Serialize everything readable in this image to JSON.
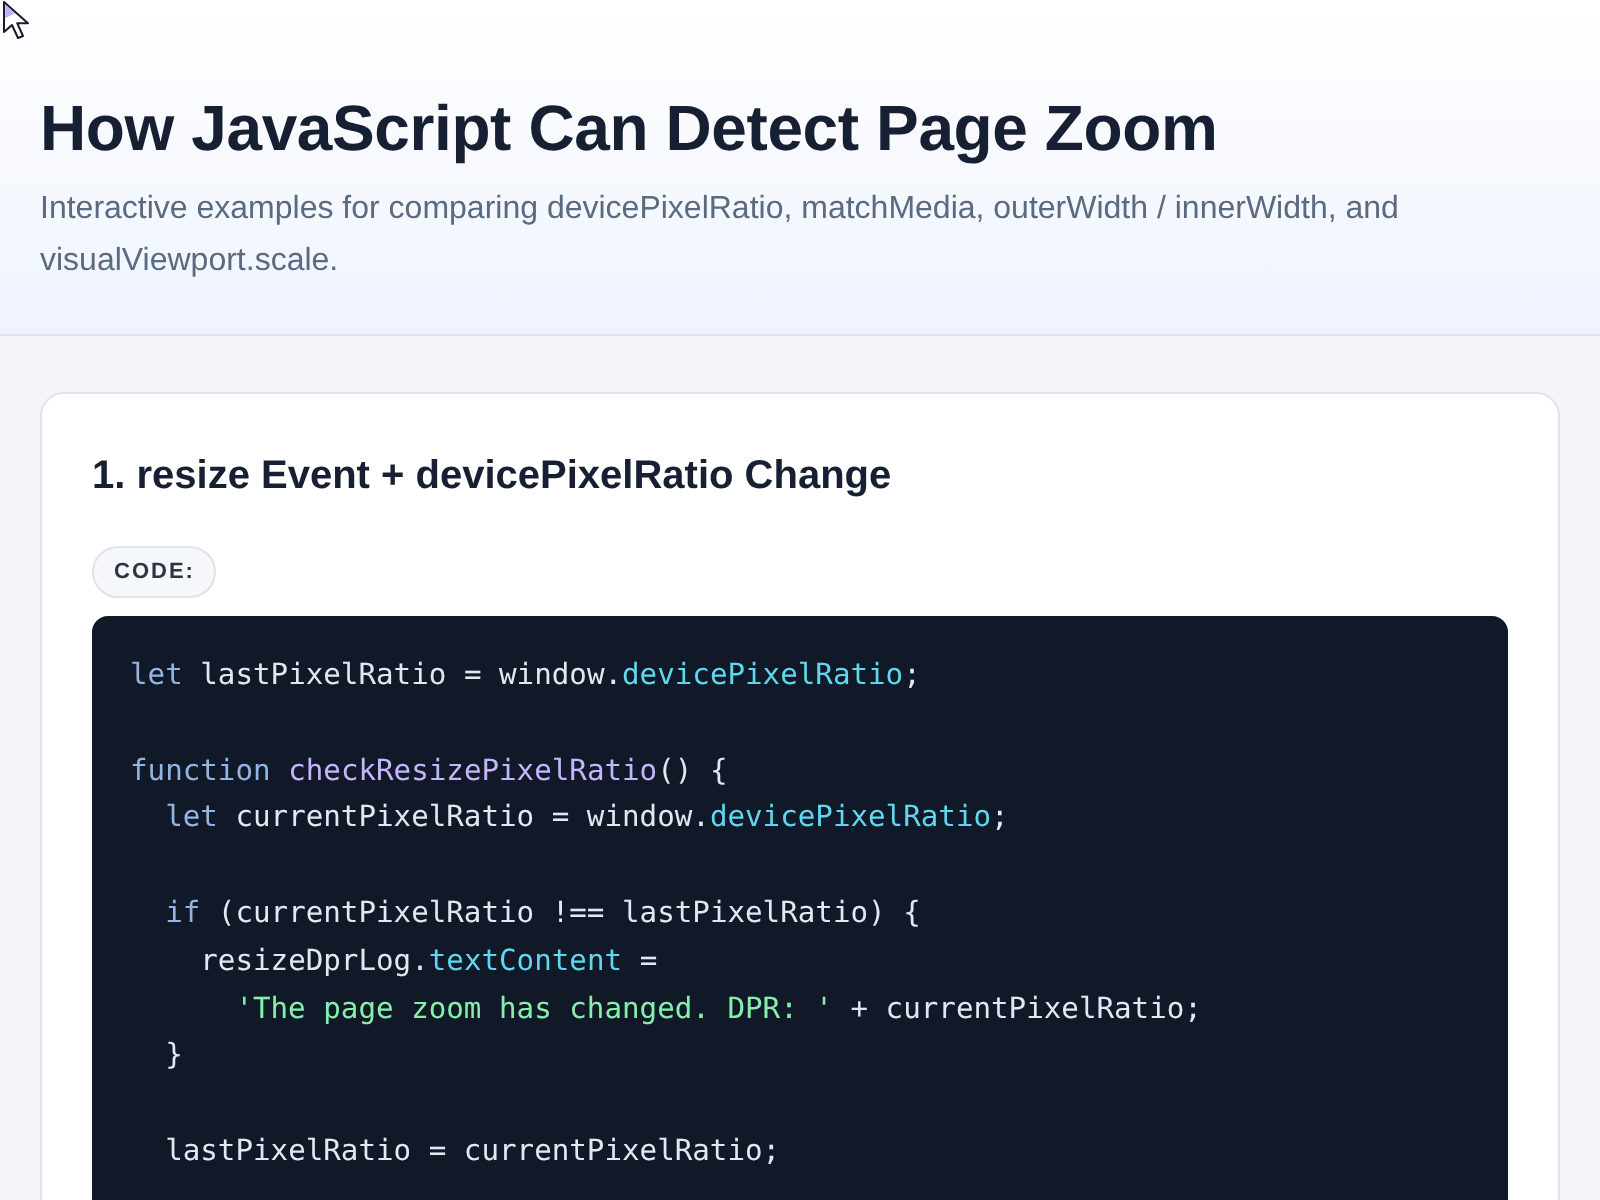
{
  "header": {
    "title": "How JavaScript Can Detect Page Zoom",
    "subtitle": "Interactive examples for comparing devicePixelRatio, matchMedia, outerWidth / innerWidth, and visualViewport.scale."
  },
  "sections": [
    {
      "heading": "1. resize Event + devicePixelRatio Change",
      "code_label": "CODE:",
      "code_lines": [
        {
          "kind": "code",
          "tokens": [
            {
              "kind": "keyword",
              "text": "let"
            },
            {
              "kind": "plain",
              "text": " lastPixelRatio = window."
            },
            {
              "kind": "property",
              "text": "devicePixelRatio"
            },
            {
              "kind": "plain",
              "text": ";"
            }
          ]
        },
        {
          "kind": "blank"
        },
        {
          "kind": "code",
          "tokens": [
            {
              "kind": "keyword",
              "text": "function"
            },
            {
              "kind": "function",
              "text": " checkResizePixelRatio"
            },
            {
              "kind": "plain",
              "text": "() {"
            }
          ],
          "children": [
            {
              "kind": "code",
              "tokens": [
                {
                  "kind": "keyword",
                  "text": "let"
                },
                {
                  "kind": "plain",
                  "text": " currentPixelRatio = window."
                },
                {
                  "kind": "property",
                  "text": "devicePixelRatio"
                },
                {
                  "kind": "plain",
                  "text": ";"
                }
              ]
            },
            {
              "kind": "blank"
            },
            {
              "kind": "code",
              "tokens": [
                {
                  "kind": "keyword",
                  "text": "if"
                },
                {
                  "kind": "plain",
                  "text": " (currentPixelRatio !== lastPixelRatio) {"
                }
              ],
              "children": [
                {
                  "kind": "code",
                  "tokens": [
                    {
                      "kind": "plain",
                      "text": "resizeDprLog."
                    },
                    {
                      "kind": "property",
                      "text": "textContent"
                    },
                    {
                      "kind": "plain",
                      "text": " ="
                    }
                  ],
                  "children": [
                    {
                      "kind": "code",
                      "tokens": [
                        {
                          "kind": "string",
                          "text": "'The page zoom has changed. DPR: '"
                        },
                        {
                          "kind": "plain",
                          "text": " + currentPixelRatio;"
                        }
                      ]
                    }
                  ]
                }
              ]
            },
            {
              "kind": "code",
              "tokens": [
                {
                  "kind": "plain",
                  "text": "}"
                }
              ]
            },
            {
              "kind": "blank"
            },
            {
              "kind": "code",
              "tokens": [
                {
                  "kind": "plain",
                  "text": "lastPixelRatio = currentPixelRatio;"
                }
              ]
            }
          ]
        }
      ]
    }
  ]
}
